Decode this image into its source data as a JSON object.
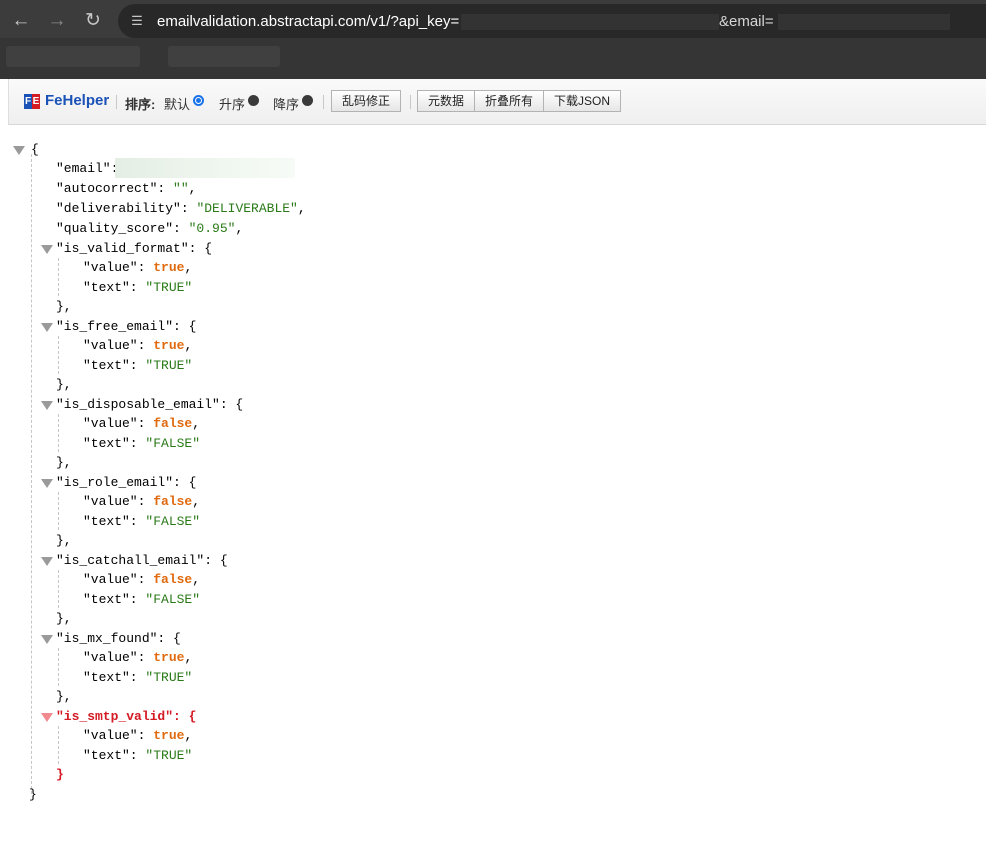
{
  "browser": {
    "url_host": "emailvalidation.abstractapi.com/v1/?api_key=",
    "url_email_param": "&email=",
    "icons": {
      "back": "arrow-left-icon",
      "forward": "arrow-right-icon",
      "reload": "reload-icon",
      "site_info": "tune-icon"
    }
  },
  "toolbar": {
    "logo_letters": "FE",
    "title": "FeHelper",
    "sort_label": "排序:",
    "sort_options": [
      {
        "label": "默认",
        "selected": true
      },
      {
        "label": "升序",
        "selected": false
      },
      {
        "label": "降序",
        "selected": false
      }
    ],
    "buttons": {
      "fix_encoding": "乱码修正",
      "raw": "元数据",
      "collapse_all": "折叠所有",
      "download": "下载JSON"
    },
    "accent_color": "#1a73e8",
    "brand_color": "#1a52b8"
  },
  "json": {
    "open_brace": "{",
    "close_brace": "}",
    "lines": {
      "email_key": "\"email\":",
      "autocorrect_key": "\"autocorrect\": ",
      "autocorrect_val": "\"\"",
      "deliverability_key": "\"deliverability\": ",
      "deliverability_val": "\"DELIVERABLE\"",
      "quality_key": "\"quality_score\": ",
      "quality_val": "\"0.95\""
    },
    "objects": [
      {
        "key": "\"is_valid_format\": {",
        "value": "true",
        "text": "\"TRUE\"",
        "close": "},"
      },
      {
        "key": "\"is_free_email\": {",
        "value": "true",
        "text": "\"TRUE\"",
        "close": "},"
      },
      {
        "key": "\"is_disposable_email\": {",
        "value": "false",
        "text": "\"FALSE\"",
        "close": "},"
      },
      {
        "key": "\"is_role_email\": {",
        "value": "false",
        "text": "\"FALSE\"",
        "close": "},"
      },
      {
        "key": "\"is_catchall_email\": {",
        "value": "false",
        "text": "\"FALSE\"",
        "close": "},"
      },
      {
        "key": "\"is_mx_found\": {",
        "value": "true",
        "text": "\"TRUE\"",
        "close": "},"
      },
      {
        "key": "\"is_smtp_valid\": {",
        "value": "true",
        "text": "\"TRUE\"",
        "close": "}"
      }
    ],
    "value_key": "\"value\": ",
    "text_key": "\"text\": ",
    "comma": ",",
    "colors": {
      "string": "#2a7a18",
      "boolean": "#e06a0f",
      "highlight": "#d41b24"
    }
  }
}
